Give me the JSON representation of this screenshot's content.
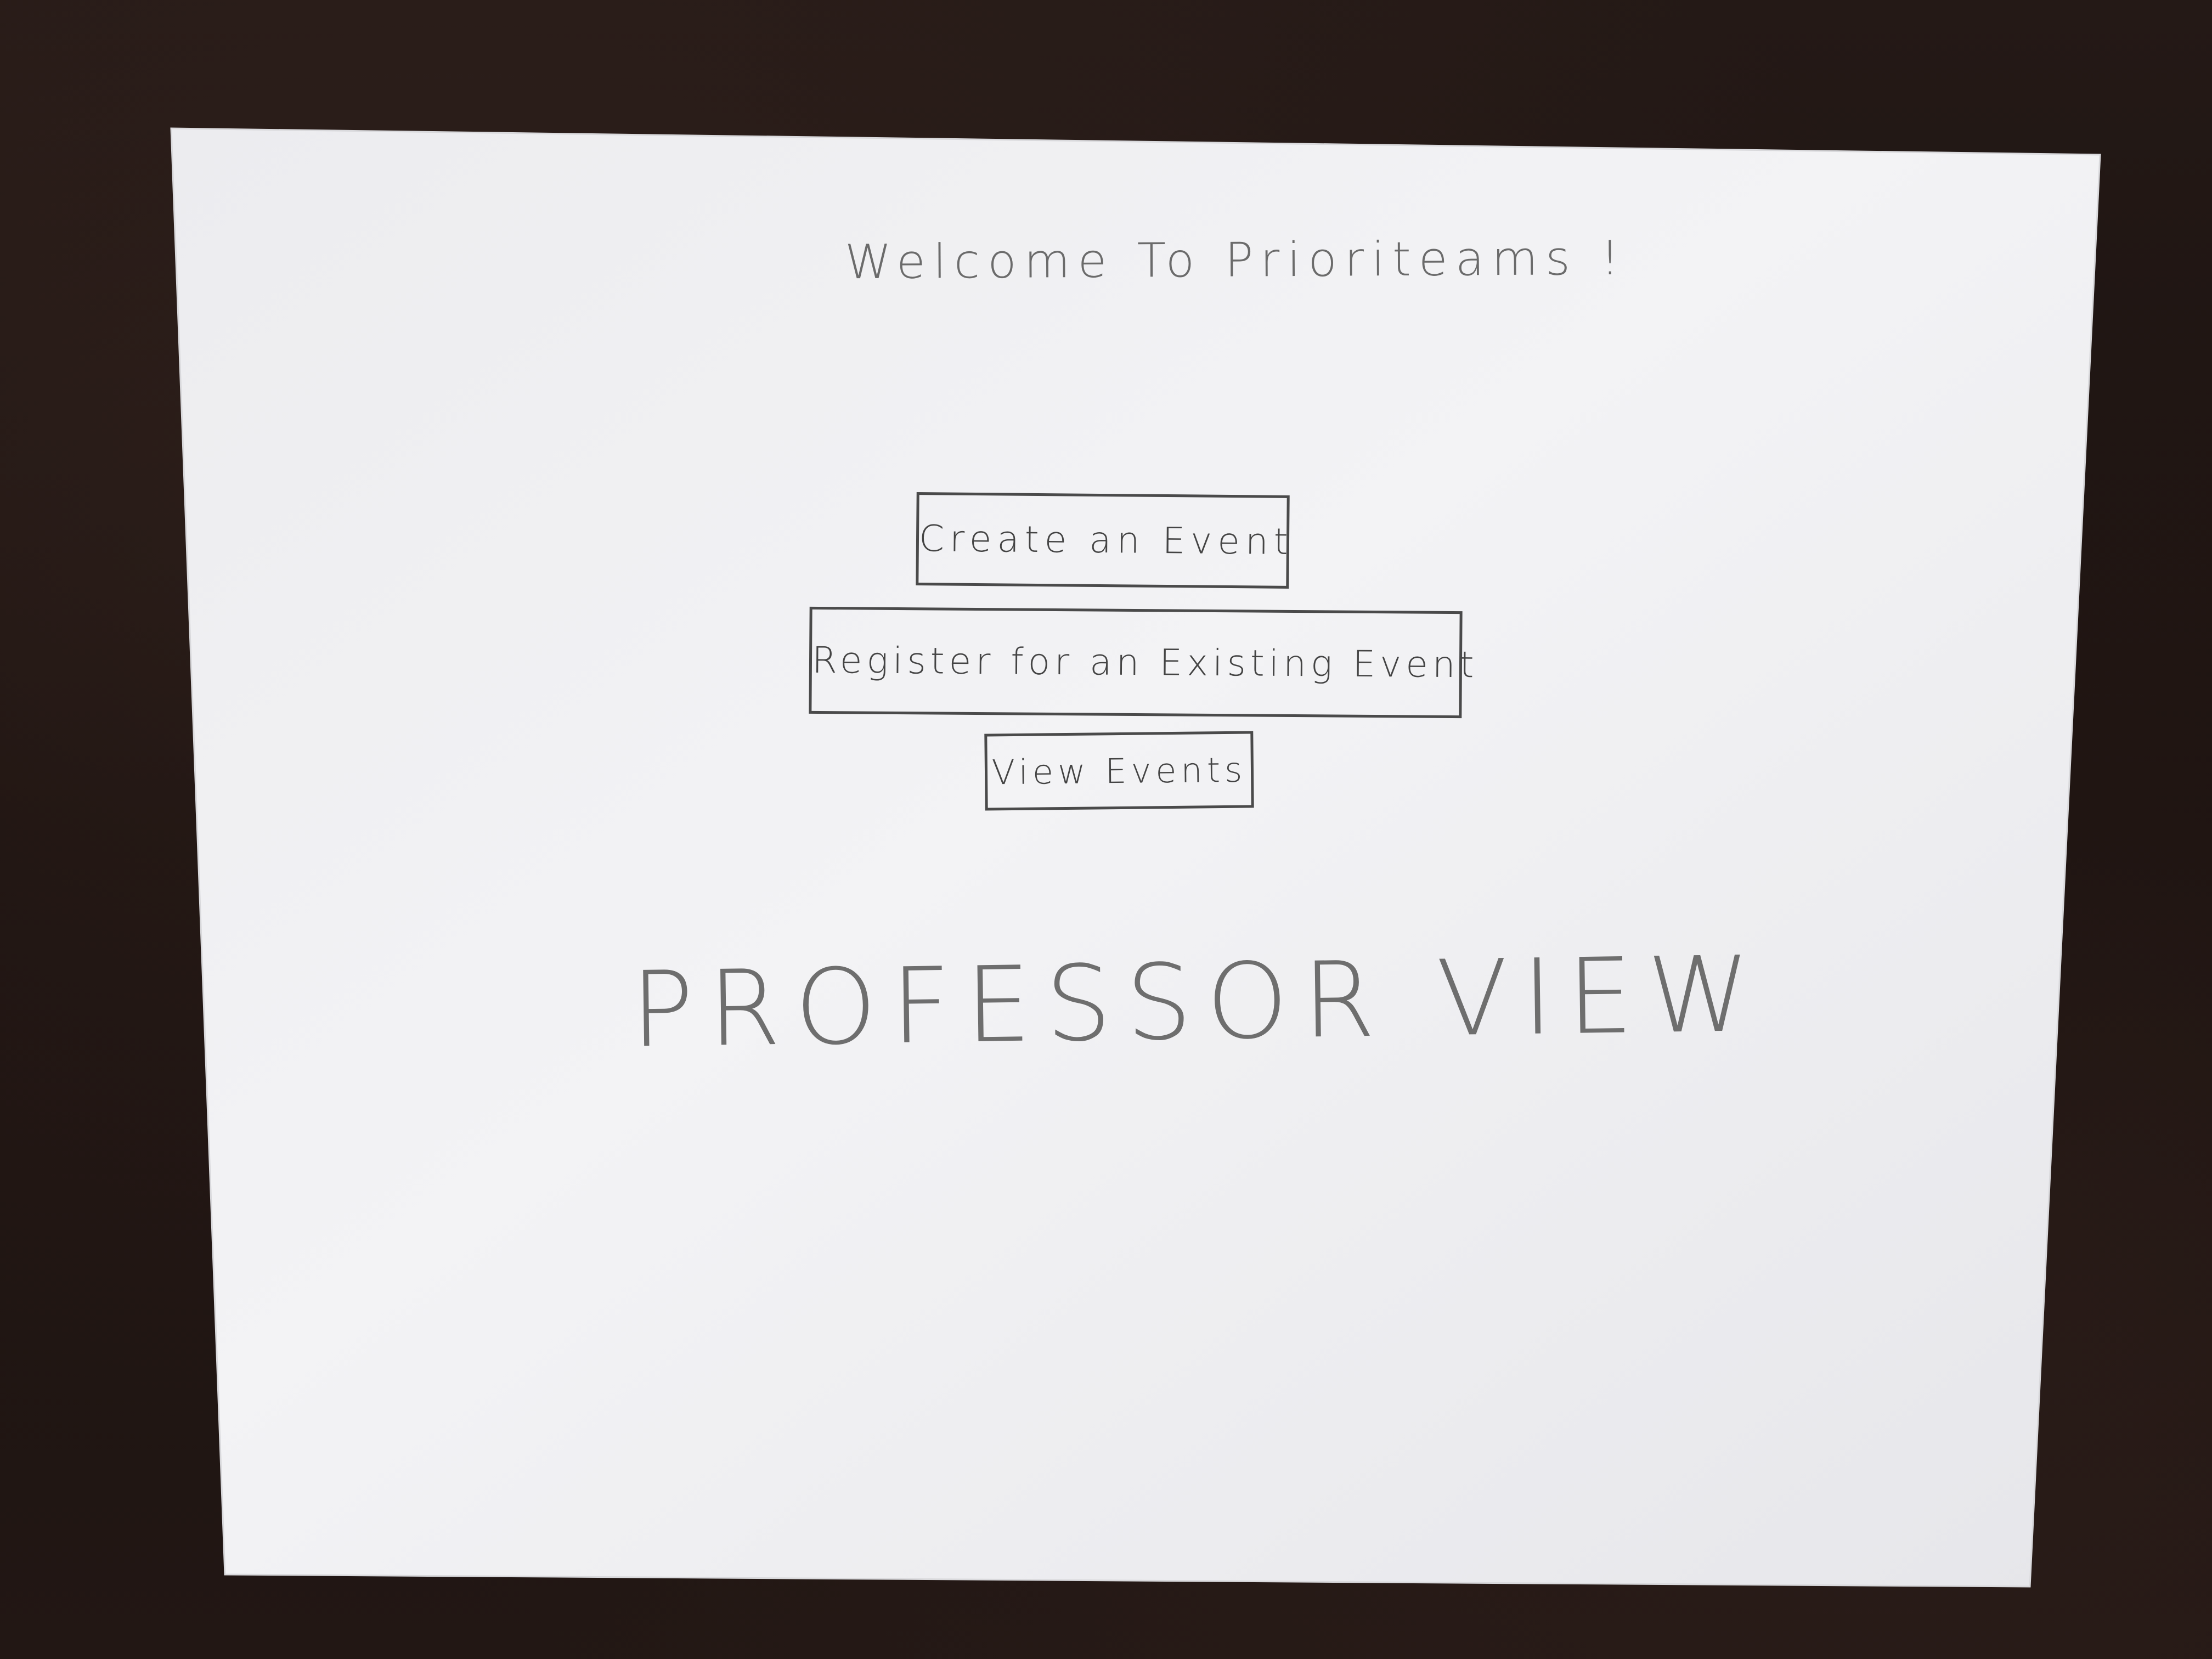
{
  "header": {
    "title": "Welcome To Prioriteams !"
  },
  "actions": {
    "create_label": "Create an Event",
    "register_label": "Register for an Existing Event",
    "view_label": "View Events"
  },
  "footer": {
    "view_mode": "PROFESSOR VIEW"
  },
  "colors": {
    "paper": "#f1f1f3",
    "pencil": "#4a4a4a",
    "table": "#1c1311"
  }
}
